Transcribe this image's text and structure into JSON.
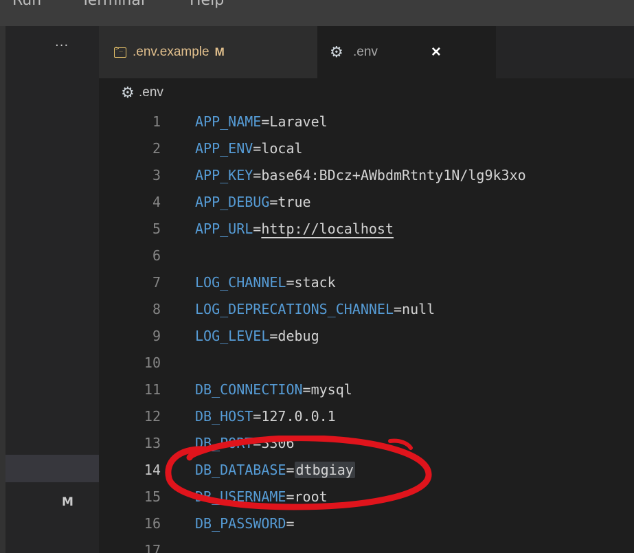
{
  "menubar": {
    "items": [
      "Run",
      "Terminal",
      "Help"
    ]
  },
  "sidebar": {
    "more_label": "···",
    "modified_badge": "M"
  },
  "tabs": [
    {
      "label": ".env.example",
      "status": "M",
      "icon": "terminal-icon"
    },
    {
      "label": ".env",
      "icon": "gear-icon",
      "close": "×"
    }
  ],
  "breadcrumb": {
    "file": ".env",
    "icon": "gear-icon"
  },
  "editor": {
    "lines": [
      {
        "num": "1",
        "key": "APP_NAME",
        "eq": "=",
        "value": "Laravel"
      },
      {
        "num": "2",
        "key": "APP_ENV",
        "eq": "=",
        "value": "local"
      },
      {
        "num": "3",
        "key": "APP_KEY",
        "eq": "=",
        "value": "base64:BDcz+AWbdmRtnty1N/lg9k3xo"
      },
      {
        "num": "4",
        "key": "APP_DEBUG",
        "eq": "=",
        "value": "true"
      },
      {
        "num": "5",
        "key": "APP_URL",
        "eq": "=",
        "value": "http://localhost"
      },
      {
        "num": "6",
        "key": "",
        "eq": "",
        "value": ""
      },
      {
        "num": "7",
        "key": "LOG_CHANNEL",
        "eq": "=",
        "value": "stack"
      },
      {
        "num": "8",
        "key": "LOG_DEPRECATIONS_CHANNEL",
        "eq": "=",
        "value": "null"
      },
      {
        "num": "9",
        "key": "LOG_LEVEL",
        "eq": "=",
        "value": "debug"
      },
      {
        "num": "10",
        "key": "",
        "eq": "",
        "value": ""
      },
      {
        "num": "11",
        "key": "DB_CONNECTION",
        "eq": "=",
        "value": "mysql"
      },
      {
        "num": "12",
        "key": "DB_HOST",
        "eq": "=",
        "value": "127.0.0.1"
      },
      {
        "num": "13",
        "key": "DB_PORT",
        "eq": "=",
        "value": "3306"
      },
      {
        "num": "14",
        "key": "DB_DATABASE",
        "eq": "=",
        "value": "dtbgiay"
      },
      {
        "num": "15",
        "key": "DB_USERNAME",
        "eq": "=",
        "value": "root"
      },
      {
        "num": "16",
        "key": "DB_PASSWORD",
        "eq": "=",
        "value": ""
      },
      {
        "num": "17",
        "key": "",
        "eq": "",
        "value": ""
      }
    ]
  },
  "colors": {
    "annotation": "#e0141c",
    "key": "#569cd6",
    "modified": "#e2c08d"
  }
}
